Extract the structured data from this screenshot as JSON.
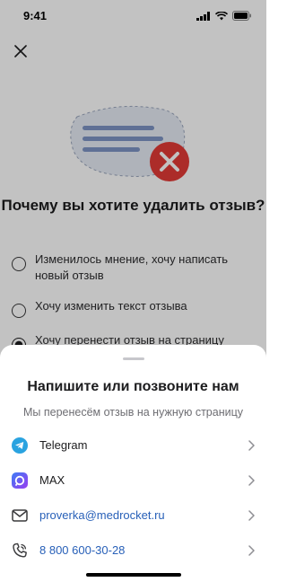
{
  "status_bar": {
    "time": "9:41"
  },
  "page": {
    "question": "Почему вы хотите удалить отзыв?",
    "options": [
      {
        "label": "Изменилось мнение, хочу написать новый отзыв",
        "checked": false
      },
      {
        "label": "Хочу изменить текст отзыва",
        "checked": false
      },
      {
        "label": "Хочу перенести отзыв на страницу",
        "checked": true
      }
    ]
  },
  "sheet": {
    "title": "Напишите или позвоните нам",
    "subtitle": "Мы перенесём отзыв на нужную страницу",
    "contacts": [
      {
        "label": "Telegram",
        "icon": "telegram-icon"
      },
      {
        "label": "MAX",
        "icon": "max-icon"
      },
      {
        "label": "proverka@medrocket.ru",
        "icon": "mail-icon"
      },
      {
        "label": "8 800 600-30-28",
        "icon": "phone-icon"
      }
    ]
  },
  "colors": {
    "accent_link": "#2860b8",
    "delete_red": "#e23b36",
    "telegram_blue": "#2aa3e0"
  }
}
